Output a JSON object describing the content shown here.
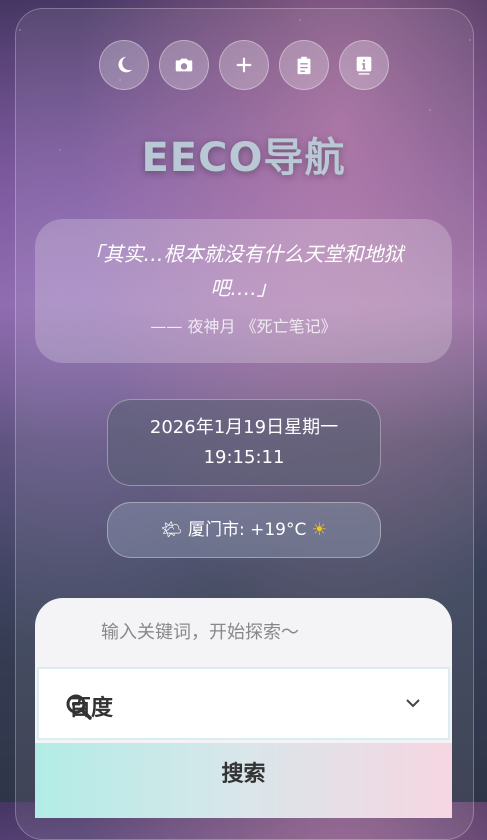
{
  "toolbar": {
    "buttons": [
      {
        "icon": "moon-icon"
      },
      {
        "icon": "camera-icon"
      },
      {
        "icon": "plus-icon"
      },
      {
        "icon": "clipboard-icon"
      },
      {
        "icon": "info-icon"
      }
    ]
  },
  "site": {
    "title": "EECO导航"
  },
  "quote": {
    "text": "「其实…根本就没有什么天堂和地狱吧….」",
    "source": "—— 夜神月 《死亡笔记》"
  },
  "clock": {
    "date": "2026年1月19日星期一",
    "time": "19:15:11"
  },
  "weather": {
    "icon_left": "🌤",
    "text": "厦门市: +19°C",
    "icon_right": "☀"
  },
  "search": {
    "placeholder": "输入关键词，开始探索～",
    "engine": "百度",
    "button_label": "搜索"
  }
}
